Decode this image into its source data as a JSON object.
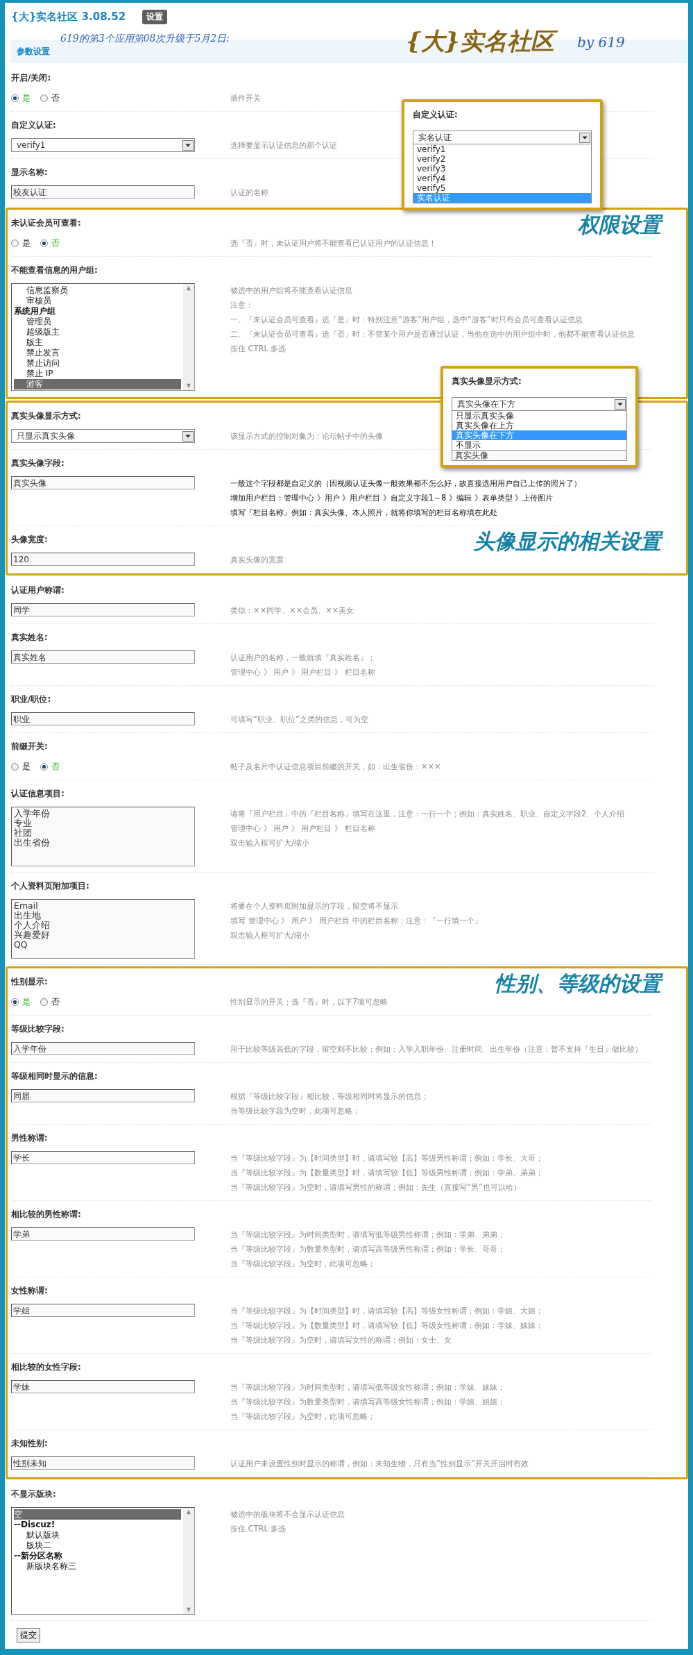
{
  "header": {
    "title": "{大}实名社区 3.08.52",
    "badge": "设置"
  },
  "banner": {
    "note": "619的第3个应用第08次升级于5月2日:",
    "logo": "{大}实名社区",
    "byline": "by 619"
  },
  "section_title": "参数设置",
  "blocks": [
    {
      "kind": "plain",
      "rows": [
        {
          "kind": "radio",
          "label": "开启/关闭:",
          "options": [
            {
              "label": "是",
              "selected": true
            },
            {
              "label": "否",
              "selected": false
            }
          ],
          "dark_hint": false,
          "hint": [
            "插件开关"
          ]
        },
        {
          "kind": "select",
          "label": "自定义认证:",
          "value": "verify1",
          "dark_hint": false,
          "hint": [
            "选择要显示认证信息的那个认证"
          ]
        },
        {
          "kind": "text",
          "label": "显示名称:",
          "value": "校友认证",
          "dark_hint": false,
          "hint": [
            "认证的名称"
          ]
        }
      ]
    },
    {
      "kind": "annotated",
      "rows": [
        {
          "kind": "radio",
          "caption": "权限设置",
          "label": "未认证会员可查看:",
          "options": [
            {
              "label": "是",
              "selected": false
            },
            {
              "label": "否",
              "selected": true
            }
          ],
          "dark_hint": false,
          "hint": [
            "选『否』时，未认证用户将不能查看已认证用户的认证信息！"
          ]
        },
        {
          "kind": "listbox",
          "label": "不能查看信息的用户组:",
          "items": [
            {
              "kind": "option",
              "text": "信息监察员",
              "selected": false
            },
            {
              "kind": "option",
              "text": "审核员",
              "selected": false
            },
            {
              "kind": "group",
              "text": "系统用户组",
              "selected": false,
              "children": [
                {
                  "kind": "option",
                  "text": "管理员",
                  "selected": false
                },
                {
                  "kind": "option",
                  "text": "超级版主",
                  "selected": false
                },
                {
                  "kind": "option",
                  "text": "版主",
                  "selected": false
                },
                {
                  "kind": "option",
                  "text": "禁止发言",
                  "selected": false
                },
                {
                  "kind": "option",
                  "text": "禁止访问",
                  "selected": false
                },
                {
                  "kind": "option",
                  "text": "禁止 IP",
                  "selected": false
                },
                {
                  "kind": "option",
                  "text": "游客",
                  "selected": true
                }
              ]
            }
          ],
          "dark_hint": false,
          "hint": [
            "被选中的用户组将不能查看认证信息",
            "注意：",
            "一、『未认证会员可查看』选『是』时：特别注意“游客”用户组，选中“游客”时只有会员可查看认证信息",
            "二、『未认证会员可查看』选『否』时：不管某个用户是否通过认证，当他在选中的用户组中时，他都不能查看认证信息",
            "按住 CTRL 多选"
          ]
        }
      ]
    },
    {
      "kind": "annotated",
      "rows": [
        {
          "kind": "select",
          "label": "真实头像显示方式:",
          "value": "只显示真实头像",
          "dark_hint": false,
          "hint": [
            "该显示方式的控制对象为：论坛帖子中的头像"
          ]
        },
        {
          "kind": "text",
          "label": "真实头像字段:",
          "value": "真实头像",
          "dark_hint": true,
          "hint": [
            "一般这个字段都是自定义的（因视频认证头像一般效果都不怎么好，故直接选用用户自己上传的照片了）",
            "增加用户栏目：管理中心 》用户 》用户栏目 》自定义字段1～8 》编辑 》表单类型 》上传图片",
            "填写『栏目名称』例如：真实头像、本人照片，就将你填写的栏目名称填在此处"
          ]
        },
        {
          "kind": "text",
          "caption": "头像显示的相关设置",
          "label": "头像宽度:",
          "value": "120",
          "dark_hint": false,
          "hint": [
            "真实头像的宽度"
          ]
        }
      ]
    },
    {
      "kind": "plain",
      "rows": [
        {
          "kind": "text",
          "label": "认证用户称谓:",
          "value": "同学",
          "dark_hint": false,
          "hint": [
            "类似：××同学、××会员、××美女"
          ]
        },
        {
          "kind": "text",
          "label": "真实姓名:",
          "value": "真实姓名",
          "dark_hint": false,
          "hint": [
            "认证用户的名称，一般就填『真实姓名』；",
            "管理中心 》 用户 》 用户栏目 》 栏目名称"
          ]
        },
        {
          "kind": "text",
          "label": "职业/职位:",
          "value": "职业",
          "dark_hint": false,
          "hint": [
            "可填写“职业、职位”之类的信息，可为空"
          ]
        },
        {
          "kind": "radio",
          "label": "前缀开关:",
          "options": [
            {
              "label": "是",
              "selected": false
            },
            {
              "label": "否",
              "selected": true
            }
          ],
          "dark_hint": false,
          "hint": [
            "帖子及名片中认证信息项目前缀的开关，如：出生省份：×××"
          ]
        },
        {
          "kind": "textarea",
          "label": "认证信息项目:",
          "lines": [
            "入学年份",
            "专业",
            "社团",
            "出生省份"
          ],
          "dark_hint": false,
          "hint": [
            "请将『用户栏目』中的『栏目名称』填写在这里，注意：一行一个；例如：真实姓名、职业、自定义字段2、个人介绍",
            "管理中心 》 用户 》 用户栏目 》 栏目名称",
            "双击输入框可扩大/缩小"
          ]
        },
        {
          "kind": "textarea",
          "label": "个人资料页附加项目:",
          "lines": [
            "Email",
            "出生地",
            "个人介绍",
            "兴趣爱好",
            "QQ"
          ],
          "dark_hint": false,
          "hint": [
            "将要在个人资料页附加显示的字段，留空将不显示",
            "填写 管理中心 》 用户 》 用户栏目 中的栏目名称；注意：『一行填一个』",
            "双击输入框可扩大/缩小"
          ]
        }
      ]
    },
    {
      "kind": "annotated",
      "rows": [
        {
          "kind": "radio",
          "caption": "性别、等级的设置",
          "label": "性别显示:",
          "options": [
            {
              "label": "是",
              "selected": true
            },
            {
              "label": "否",
              "selected": false
            }
          ],
          "dark_hint": false,
          "hint": [
            "性别显示的开关；选『否』时，以下7项可忽略"
          ]
        },
        {
          "kind": "text",
          "label": "等级比较字段:",
          "value": "入学年份",
          "dark_hint": false,
          "hint": [
            "用于比较等级高低的字段，留空则不比较；例如：入学入职年份、注册时间、出生年份（注意：暂不支持『生日』做比较）"
          ]
        },
        {
          "kind": "text",
          "label": "等级相同时显示的信息:",
          "value": "同届",
          "dark_hint": false,
          "hint": [
            "根据『等级比较字段』相比较，等级相同时将显示的信息；",
            "当等级比较字段为空时，此项可忽略；"
          ]
        },
        {
          "kind": "text",
          "label": "男性称谓:",
          "value": "学长",
          "dark_hint": false,
          "hint": [
            "当『等级比较字段』为【时间类型】时，请填写较【高】等级男性称谓；例如：学长、大哥；",
            "当『等级比较字段』为【数量类型】时，请填写较【低】等级男性称谓；例如：学弟、弟弟；",
            "当『等级比较字段』为空时，请填写男性的称谓；例如：先生（直接写“男”也可以哈）"
          ]
        },
        {
          "kind": "text",
          "label": "相比较的男性称谓:",
          "value": "学弟",
          "dark_hint": false,
          "hint": [
            "当『等级比较字段』为时间类型时，请填写低等级男性称谓；例如：学弟、弟弟；",
            "当『等级比较字段』为数量类型时，请填写高等级男性称谓；例如：学长、哥哥；",
            "当『等级比较字段』为空时，此项可忽略；"
          ]
        },
        {
          "kind": "text",
          "label": "女性称谓:",
          "value": "学姐",
          "dark_hint": false,
          "hint": [
            "当『等级比较字段』为【时间类型】时，请填写较【高】等级女性称谓；例如：学姐、大姐；",
            "当『等级比较字段』为【数量类型】时，请填写较【低】等级女性称谓；例如：学妹、妹妹；",
            "当『等级比较字段』为空时，请填写女性的称谓；例如：女士、女"
          ]
        },
        {
          "kind": "text",
          "label": "相比较的女性字段:",
          "value": "学妹",
          "dark_hint": false,
          "hint": [
            "当『等级比较字段』为时间类型时，请填写低等级女性称谓；例如：学妹、妹妹；",
            "当『等级比较字段』为数量类型时，请填写高等级女性称谓；例如：学姐、姐姐；",
            "当『等级比较字段』为空时，此项可忽略；"
          ]
        },
        {
          "kind": "text",
          "label": "未知性别:",
          "value": "性别未知",
          "dark_hint": false,
          "hint": [
            "认证用户未设置性别时显示的称谓，例如：未知生物，只有当“性别显示”开关开启时有效"
          ]
        }
      ]
    },
    {
      "kind": "plain",
      "rows": [
        {
          "kind": "listbox",
          "label": "不显示版块:",
          "items": [
            {
              "kind": "top",
              "text": "空",
              "selected": true
            },
            {
              "kind": "group",
              "text": "--Discuz!",
              "selected": false,
              "children": [
                {
                  "kind": "option",
                  "text": "默认版块",
                  "selected": false
                },
                {
                  "kind": "option",
                  "text": "版块二",
                  "selected": false
                }
              ]
            },
            {
              "kind": "group",
              "text": "--新分区名称",
              "selected": false,
              "children": [
                {
                  "kind": "option",
                  "text": "新版块名称三",
                  "selected": false
                }
              ]
            }
          ],
          "dark_hint": false,
          "hint": [
            "被选中的版块将不会显示认证信息",
            "按住 CTRL 多选"
          ]
        }
      ]
    }
  ],
  "submit": "提交",
  "callouts": [
    {
      "title": "自定义认证:",
      "value": "实名认证",
      "options": [
        {
          "text": "verify1",
          "selected": false
        },
        {
          "text": "verify2",
          "selected": false
        },
        {
          "text": "verify3",
          "selected": false
        },
        {
          "text": "verify4",
          "selected": false
        },
        {
          "text": "verify5",
          "selected": false
        },
        {
          "text": "实名认证",
          "selected": true
        }
      ]
    },
    {
      "title": "真实头像显示方式:",
      "value": "真实头像在下方",
      "options": [
        {
          "text": "只显示真实头像",
          "selected": false
        },
        {
          "text": "真实头像在上方",
          "selected": false
        },
        {
          "text": "真实头像在下方",
          "selected": true
        },
        {
          "text": "不显示",
          "selected": false
        }
      ],
      "peek": "真实头像"
    }
  ]
}
